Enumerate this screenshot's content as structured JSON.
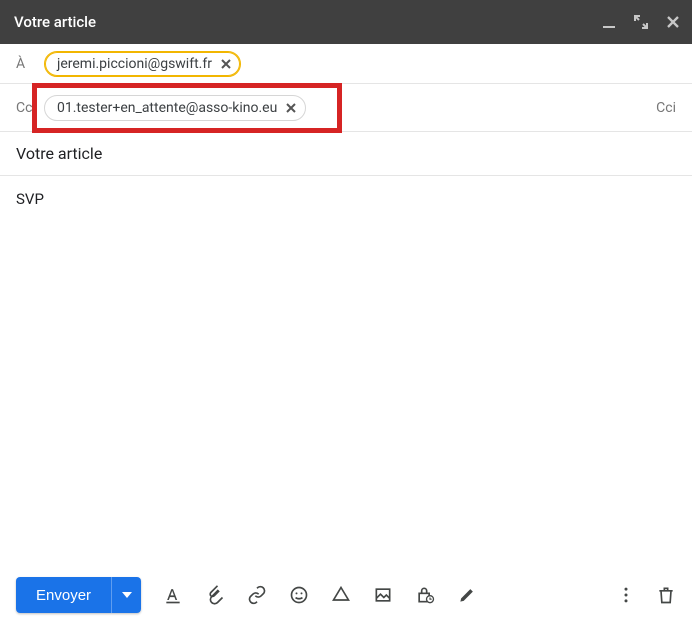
{
  "window": {
    "title": "Votre article"
  },
  "fields": {
    "to_label": "À",
    "cc_label": "Cc",
    "bcc_label": "Cci",
    "to_chip": "jeremi.piccioni@gswift.fr",
    "cc_chip": "01.tester+en_attente@asso-kino.eu"
  },
  "subject": "Votre article",
  "body": "SVP",
  "toolbar": {
    "send_label": "Envoyer"
  },
  "icons": {
    "format": "format-text-icon",
    "attach": "paperclip-icon",
    "link": "link-icon",
    "emoji": "emoji-icon",
    "drive": "drive-icon",
    "image": "image-icon",
    "confidential": "lock-clock-icon",
    "pen": "pen-icon",
    "more": "more-vert-icon",
    "trash": "trash-icon"
  }
}
